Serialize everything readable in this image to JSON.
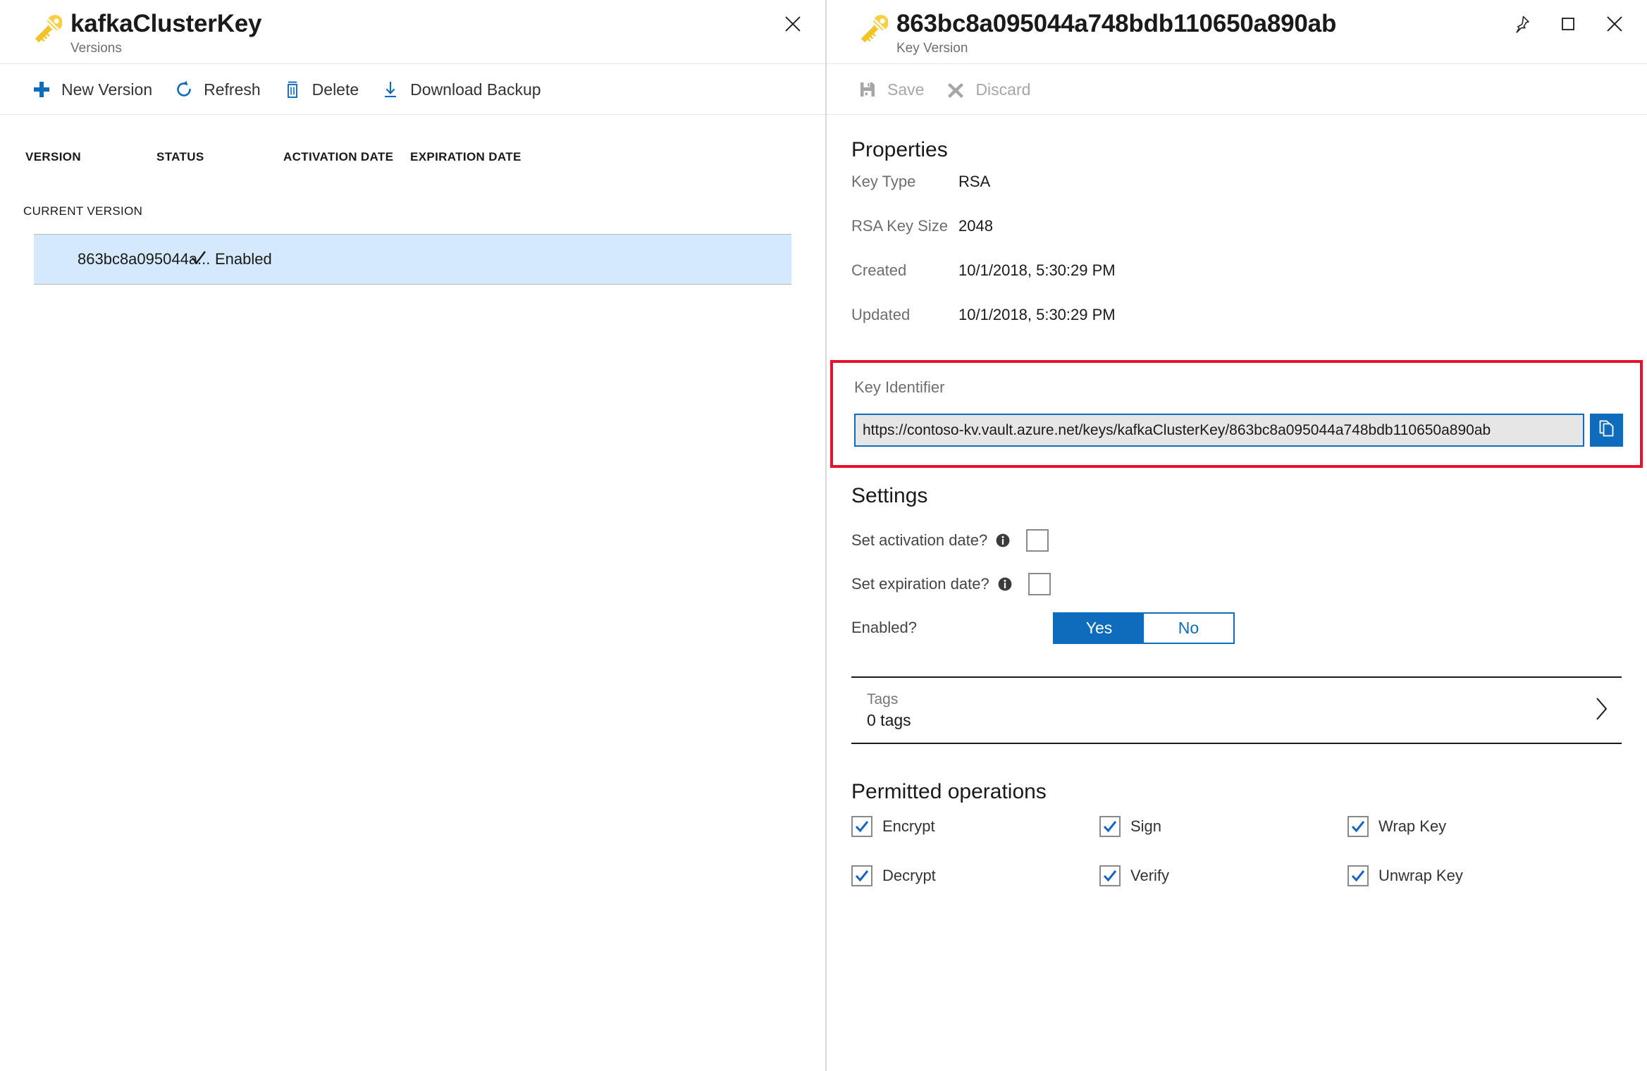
{
  "left_blade": {
    "icon": "key-icon",
    "title": "kafkaClusterKey",
    "subtitle": "Versions",
    "close_icon": "close-icon",
    "commands": [
      {
        "label": "New Version",
        "icon": "plus-icon",
        "disabled": false
      },
      {
        "label": "Refresh",
        "icon": "refresh-icon",
        "disabled": false
      },
      {
        "label": "Delete",
        "icon": "trash-icon",
        "disabled": false
      },
      {
        "label": "Download Backup",
        "icon": "download-icon",
        "disabled": false
      }
    ],
    "table": {
      "columns": [
        "VERSION",
        "STATUS",
        "ACTIVATION DATE",
        "EXPIRATION DATE"
      ],
      "group_label": "CURRENT VERSION",
      "rows": [
        {
          "version": "863bc8a095044a...",
          "status": "Enabled",
          "status_icon": "checkmark-icon",
          "activation_date": "",
          "expiration_date": "",
          "selected": true
        }
      ]
    }
  },
  "right_blade": {
    "icon": "key-icon",
    "title": "863bc8a095044a748bdb110650a890ab",
    "subtitle": "Key Version",
    "window_actions": [
      {
        "name": "pin-icon",
        "label": "Pin"
      },
      {
        "name": "maximize-icon",
        "label": "Maximize"
      },
      {
        "name": "close-icon",
        "label": "Close"
      }
    ],
    "commands": [
      {
        "label": "Save",
        "icon": "save-icon",
        "disabled": true
      },
      {
        "label": "Discard",
        "icon": "discard-icon",
        "disabled": true
      }
    ],
    "properties": {
      "title": "Properties",
      "rows": [
        {
          "label": "Key Type",
          "value": "RSA"
        },
        {
          "label": "RSA Key Size",
          "value": "2048"
        },
        {
          "label": "Created",
          "value": "10/1/2018, 5:30:29 PM"
        },
        {
          "label": "Updated",
          "value": "10/1/2018, 5:30:29 PM"
        }
      ]
    },
    "key_identifier": {
      "label": "Key Identifier",
      "value": "https://contoso-kv.vault.azure.net/keys/kafkaClusterKey/863bc8a095044a748bdb110650a890ab",
      "copy_icon": "copy-icon",
      "highlight_color": "#e8112d",
      "field_bg": "#e6e6e6",
      "field_border": "#0f6cbd"
    },
    "settings": {
      "title": "Settings",
      "activation": {
        "label": "Set activation date?",
        "info_icon": "info-icon",
        "checked": false
      },
      "expiration": {
        "label": "Set expiration date?",
        "info_icon": "info-icon",
        "checked": false
      },
      "enabled": {
        "label": "Enabled?",
        "yes_label": "Yes",
        "no_label": "No",
        "selected": "Yes"
      }
    },
    "tags": {
      "label": "Tags",
      "value": "0 tags",
      "chevron_icon": "chevron-right-icon"
    },
    "permitted_operations": {
      "title": "Permitted operations",
      "items": [
        {
          "label": "Encrypt",
          "checked": true
        },
        {
          "label": "Sign",
          "checked": true
        },
        {
          "label": "Wrap Key",
          "checked": true
        },
        {
          "label": "Decrypt",
          "checked": true
        },
        {
          "label": "Verify",
          "checked": true
        },
        {
          "label": "Unwrap Key",
          "checked": true
        }
      ]
    }
  },
  "colors": {
    "accent": "#0f6cbd",
    "key_yellow": "#f7d14a",
    "selection_blue": "#d4e9fb",
    "highlight_red": "#e8112d"
  }
}
